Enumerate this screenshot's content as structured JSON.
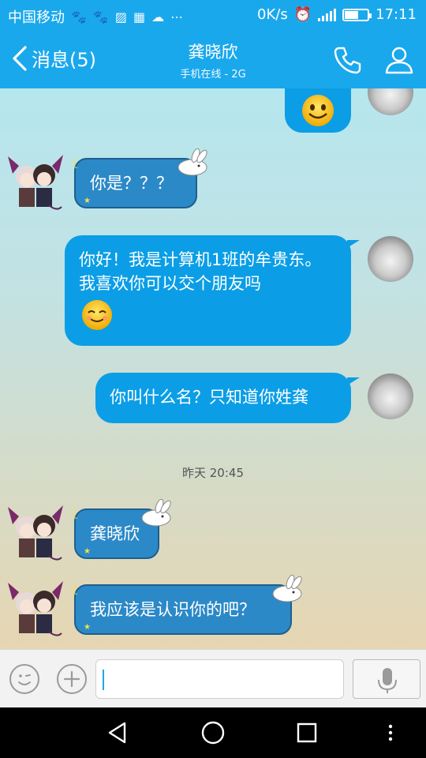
{
  "status_bar": {
    "carrier": "中国移动",
    "speed": "0K/s",
    "time": "17:11",
    "battery_level": 0.55
  },
  "header": {
    "back_label": "消息(5)",
    "contact_name": "龚晓欣",
    "contact_status": "手机在线 - 2G"
  },
  "messages": [
    {
      "from": "friend",
      "text": "你是？？？"
    },
    {
      "from": "me",
      "text": "你好！我是计算机1班的牟贵东。我喜欢你可以交个朋友吗"
    },
    {
      "from": "me",
      "text": "你叫什么名？只知道你姓龚"
    },
    {
      "from": "friend",
      "text": "龚晓欣"
    },
    {
      "from": "friend",
      "text": "我应该是认识你的吧？"
    }
  ],
  "timestamp": "昨天 20:45",
  "colors": {
    "accent": "#1aa8ec",
    "my_bubble": "#0b9ee6",
    "friend_bubble": "#2c89c8"
  }
}
